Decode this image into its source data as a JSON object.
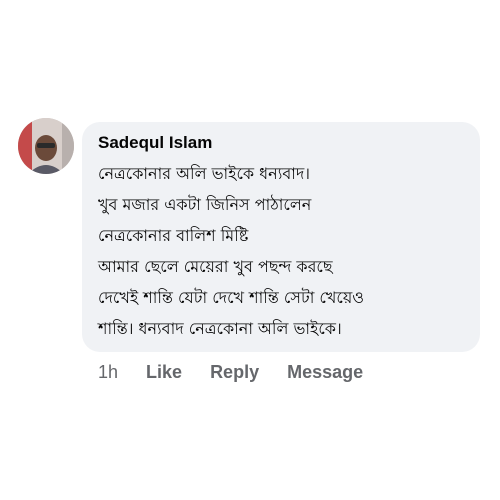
{
  "comment": {
    "author": "Sadequl Islam",
    "lines": [
      "নেত্রকোনার অলি ভাইকে ধন্যবাদ।",
      "খুব মজার একটা জিনিস পাঠালেন",
      "নেত্রকোনার বালিশ মিষ্টি",
      "আমার ছেলে মেয়েরা খুব পছন্দ করছে",
      "দেখেই শান্তি যেটা দেখে শান্তি সেটা খেয়েও",
      "শান্তি। ধন্যবাদ নেত্রকোনা অলি ভাইকে।"
    ],
    "timestamp": "1h",
    "actions": {
      "like": "Like",
      "reply": "Reply",
      "message": "Message"
    }
  },
  "colors": {
    "bubble": "#f0f2f5",
    "text": "#050505",
    "secondary_text": "#65676b"
  }
}
